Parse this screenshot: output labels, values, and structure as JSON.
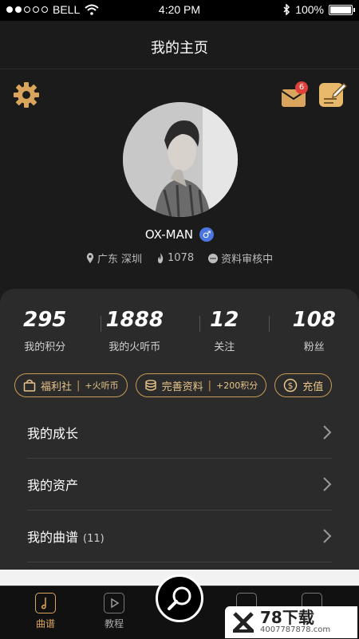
{
  "status_bar": {
    "carrier": "BELL",
    "time": "4:20 PM",
    "battery": "100%",
    "battery_level": 1.0
  },
  "header": {
    "title": "我的主页"
  },
  "icons": {
    "settings": "gear-icon",
    "messages": "mail-icon",
    "edit": "edit-note-icon",
    "gender": "male-icon"
  },
  "profile": {
    "message_badge": "6",
    "username": "OX-MAN",
    "gender_symbol": "♂",
    "location": "广东 深圳",
    "heat": "1078",
    "review_status": "资料审核中"
  },
  "stats": [
    {
      "value": "295",
      "label": "我的积分"
    },
    {
      "value": "1888",
      "label": "我的火听币"
    },
    {
      "value": "12",
      "label": "关注"
    },
    {
      "value": "108",
      "label": "粉丝"
    }
  ],
  "pills": [
    {
      "label": "福利社",
      "sub": "+火听币"
    },
    {
      "label": "完善资料",
      "sub": "+200积分"
    },
    {
      "label": "充值",
      "sub": ""
    }
  ],
  "menu": [
    {
      "label": "我的成长",
      "count": ""
    },
    {
      "label": "我的资产",
      "count": ""
    },
    {
      "label": "我的曲谱",
      "count": "(11)"
    }
  ],
  "tabs": [
    {
      "label": "曲谱"
    },
    {
      "label": "教程"
    }
  ],
  "watermark": {
    "title": "78下载",
    "sub": "4007787878.com"
  },
  "colors": {
    "accent": "#d9a45b",
    "gold": "#e8c58a",
    "badge": "#e0403a",
    "gender": "#4b76e0"
  }
}
